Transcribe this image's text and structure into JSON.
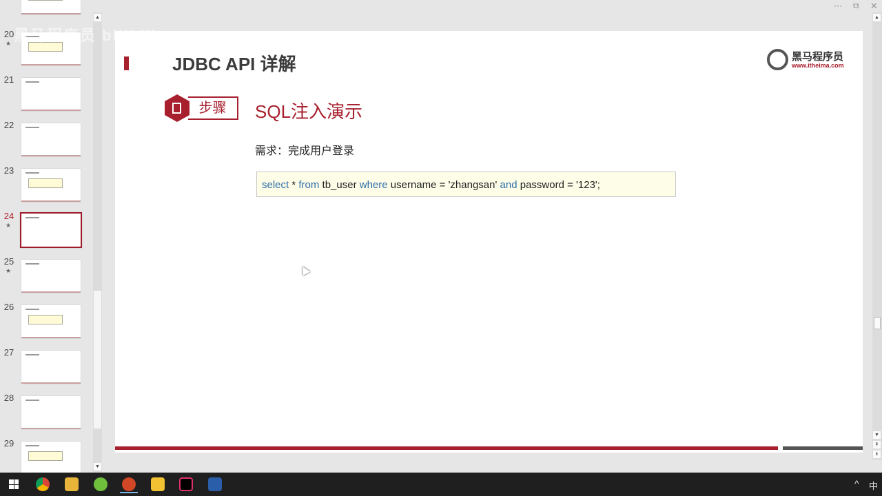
{
  "window_controls": {
    "more": "···",
    "restore": "⧉",
    "close": "✕"
  },
  "thumbnails": [
    {
      "num": "20",
      "star": "★"
    },
    {
      "num": "21",
      "star": ""
    },
    {
      "num": "22",
      "star": ""
    },
    {
      "num": "23",
      "star": ""
    },
    {
      "num": "24",
      "star": "★",
      "active": true
    },
    {
      "num": "25",
      "star": "★"
    },
    {
      "num": "26",
      "star": ""
    },
    {
      "num": "27",
      "star": ""
    },
    {
      "num": "28",
      "star": ""
    },
    {
      "num": "29",
      "star": ""
    }
  ],
  "watermark": "黑马程序员 bilibili",
  "slide": {
    "title": "JDBC API 详解",
    "logo": {
      "name": "黑马程序员",
      "url": "www.itheima.com"
    },
    "step_label": "步骤",
    "heading": "SQL注入演示",
    "requirement": "需求：完成用户登录",
    "code": [
      {
        "t": "select",
        "kw": true
      },
      {
        "t": " * ",
        "kw": false
      },
      {
        "t": "from",
        "kw": true
      },
      {
        "t": " tb_user ",
        "kw": false
      },
      {
        "t": "where",
        "kw": true
      },
      {
        "t": " username = 'zhangsan' ",
        "kw": false
      },
      {
        "t": "and",
        "kw": true
      },
      {
        "t": " password = '123';",
        "kw": false
      }
    ]
  },
  "colors": {
    "accent": "#a8202e",
    "keyword": "#2f6da8"
  },
  "taskbar": {
    "tray_chevron": "^",
    "ime": "中"
  }
}
